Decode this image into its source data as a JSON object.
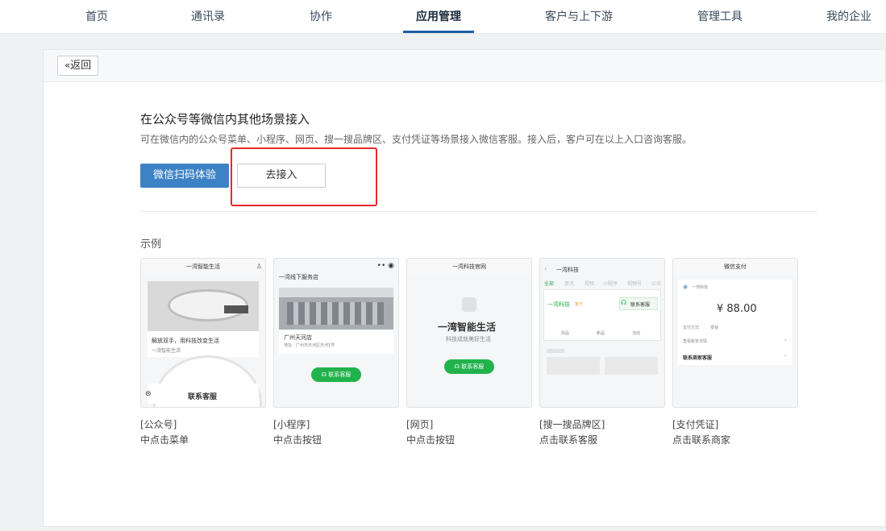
{
  "nav": {
    "items": [
      "首页",
      "通讯录",
      "协作",
      "应用管理",
      "客户与上下游",
      "管理工具",
      "我的企业"
    ],
    "active": "应用管理"
  },
  "header": {
    "back_label": "返回"
  },
  "section": {
    "title": "在公众号等微信内其他场景接入",
    "description": "可在微信内的公众号菜单、小程序、网页、搜一搜品牌区、支付凭证等场景接入微信客服。接入后，客户可在以上入口咨询客服。",
    "primary_button": "微信扫码体验",
    "secondary_button": "去接入"
  },
  "examples": {
    "label": "示例",
    "items": [
      {
        "tag": "[公众号]",
        "hint": "中点击菜单"
      },
      {
        "tag": "[小程序]",
        "hint": "中点击按钮"
      },
      {
        "tag": "[网页]",
        "hint": "中点击按钮"
      },
      {
        "tag": "[搜一搜品牌区]",
        "hint": "点击联系客服"
      },
      {
        "tag": "[支付凭证]",
        "hint": "点击联系商家"
      }
    ]
  },
  "thumbs": {
    "mp": {
      "header": "一湾智能生活",
      "caption": "解放双手，用科技改变生活",
      "sub": "一湾智能生活",
      "menu": "联系客服"
    },
    "mini": {
      "header": "一湾线下服务店",
      "store": "广州天河店",
      "address": "地址：广州市天河区天河1号",
      "button": "联系客服"
    },
    "web": {
      "header": "一湾科技官网",
      "brand": "一湾智能生活",
      "slogan": "科技成就美好生活",
      "button": "联系客服"
    },
    "search": {
      "header": "一湾科技",
      "tabs": [
        "全部",
        "资讯",
        "视频",
        "小程序",
        "视频号",
        "公众"
      ],
      "brand": "一湾科技",
      "brand_tag": "官方",
      "button": "联系客服",
      "icons": [
        "商品",
        "新品",
        "活动"
      ]
    },
    "pay": {
      "header": "微信支付",
      "merchant": "一湾科技",
      "amount": "¥ 88.00",
      "method_label": "支付方式",
      "method_value": "零钱",
      "detail": "查看账单详情",
      "contact": "联系商家客服"
    }
  },
  "colors": {
    "accent": "#3e82c6",
    "highlight": "#e8282b",
    "green": "#22b24c"
  }
}
